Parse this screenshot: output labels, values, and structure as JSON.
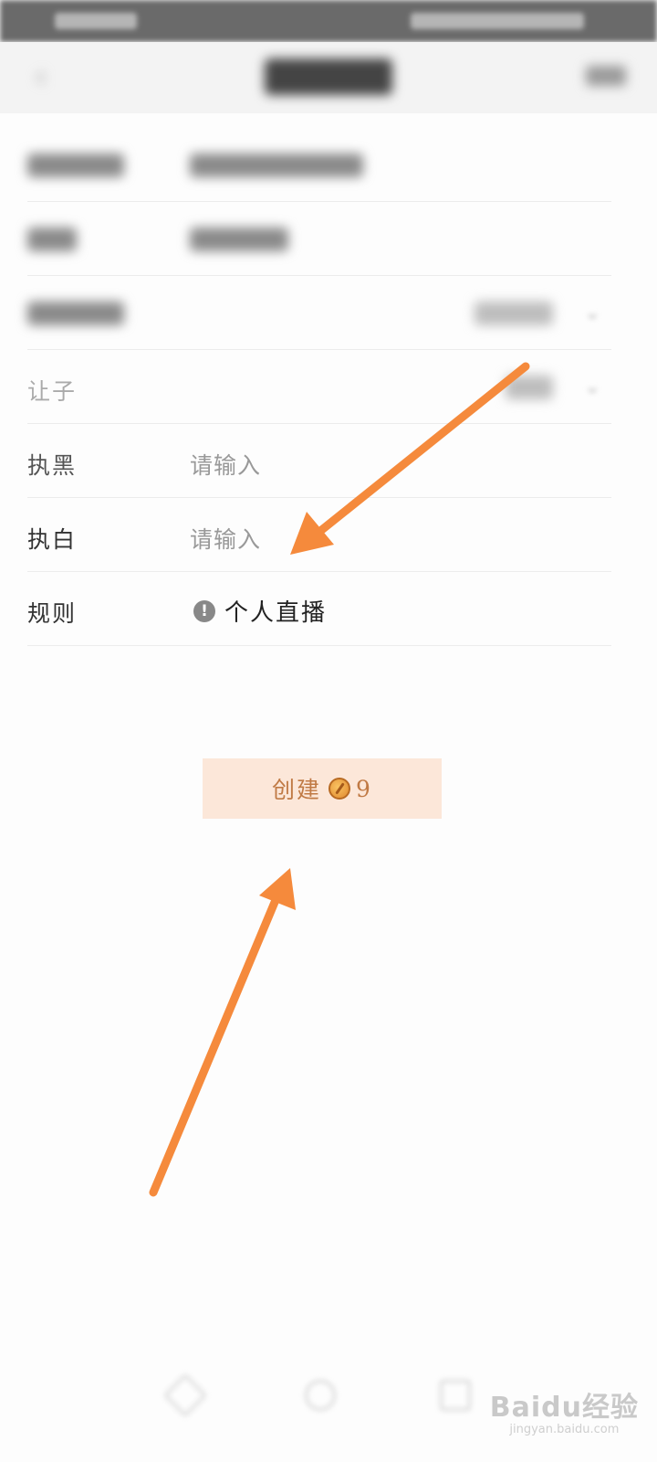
{
  "form": {
    "rows": [
      {
        "label": "执黑",
        "placeholder": "请输入"
      },
      {
        "label": "执白",
        "placeholder": "请输入"
      },
      {
        "label": "规则",
        "value": "个人直播"
      }
    ],
    "handicap_label": "让子"
  },
  "create_button": {
    "label": "创建",
    "cost": "9",
    "icon": "coin-icon"
  },
  "watermark": {
    "brand": "Baidu经验",
    "url": "jingyan.baidu.com"
  },
  "colors": {
    "accent": "#f58a3c",
    "button_bg": "#fce7d9",
    "button_text": "#c07a45"
  }
}
